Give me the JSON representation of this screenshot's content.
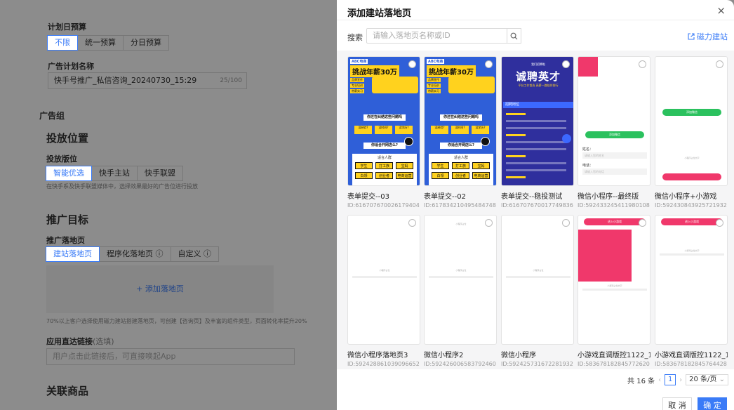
{
  "bg": {
    "budget_title": "计划日预算",
    "budget_opts": [
      "不限",
      "统一预算",
      "分日预算"
    ],
    "plan_name_label": "广告计划名称",
    "plan_name_value": "快手号推广_私信咨询_20240730_15:29",
    "plan_name_count": "25/100",
    "ad_group": "广告组",
    "placement_title": "投放位置",
    "placement_label": "投放版位",
    "placement_opts": [
      "智能优选",
      "快手主站",
      "快手联盟"
    ],
    "placement_hint": "在快手系及快手联盟媒体中，选择效果最好的广告位进行投放",
    "target_title": "推广目标",
    "landing_label": "推广落地页",
    "landing_opts": [
      "建站落地页",
      "程序化落地页 ⓘ",
      "自定义 ⓘ"
    ],
    "add_landing": "+ 添加落地页",
    "landing_hint": "70%以上客户选择使用磁力建站搭建落地页，可创建【咨询页】及丰富的组件类型，页面转化率提升20%",
    "deeplink_label": "应用直达链接",
    "deeplink_optional": "(选填)",
    "deeplink_placeholder": "用户点击此链接后，可直接唤起App",
    "product_title": "关联商品"
  },
  "drawer": {
    "title": "添加建站落地页",
    "close": "×",
    "search_label": "搜索",
    "search_placeholder": "请输入落地页名称或ID",
    "magnet_link": "磁力建站",
    "cards": [
      {
        "name": "表单提交--03",
        "id": "ID:616707670026179404",
        "kind": "poster"
      },
      {
        "name": "表单提交--02",
        "id": "ID:617834210495484748",
        "kind": "poster"
      },
      {
        "name": "表单提交--稳投测试",
        "id": "ID:616707670017749836",
        "kind": "recruit"
      },
      {
        "name": "微信小程序--最终版",
        "id": "ID:592433245411980108",
        "kind": "form"
      },
      {
        "name": "微信小程序+小游戏",
        "id": "ID:592430843925721932",
        "kind": "wechat"
      },
      {
        "name": "微信小程序落地页3",
        "id": "ID:592428861039096652",
        "kind": "blank"
      },
      {
        "name": "微信小程序2",
        "id": "ID:592426006583792460",
        "kind": "blank2"
      },
      {
        "name": "微信小程序",
        "id": "ID:592425731672281932",
        "kind": "blank"
      },
      {
        "name": "小游戏直调版控1122_1_1",
        "id": "ID:583678182845772620",
        "kind": "game"
      },
      {
        "name": "小游戏直调版控1122_1",
        "id": "ID:583678182845764428",
        "kind": "game2"
      }
    ],
    "poster": {
      "tag": "ABC电商",
      "headline": "挑战年薪30万",
      "chips": [
        "品牌宣传",
        "专业培训",
        "带薪实习"
      ],
      "q1": "你还在纠结这些问题吗",
      "opts": [
        "没经验?",
        "没时间?",
        "没学历?"
      ],
      "q2": "你适合开网店么?",
      "q3": "适合人群",
      "groups": [
        "学生",
        "打工族",
        "宝妈",
        "白领",
        "创业者",
        "电商运营"
      ]
    },
    "recruit": {
      "small": "我们招聘啦",
      "headline": "诚聘英才",
      "sub": "平台工作首选 高薪一路陪伴前行",
      "section": "招聘岗位"
    },
    "form": {
      "wx_btn": "添加微信",
      "name_label": "姓名：",
      "name_ph": "请输入您的姓名",
      "phone_label": "电话：",
      "phone_ph": "请输入您的电话"
    },
    "wechat": {
      "btn": "添加微信",
      "text": "小程序占位文字"
    },
    "blank": {
      "text": "小程序占位"
    },
    "game": {
      "btn": "进入小游戏",
      "text": "小游戏占位文字"
    },
    "pager": {
      "total": "共 16 条",
      "prev": "‹",
      "page": "1",
      "next": "›",
      "size": "20 条/页",
      "size_icon": "⌄"
    },
    "footer": {
      "cancel": "取 消",
      "ok": "确 定"
    }
  },
  "colors": {
    "accent": "#3a7bf7",
    "poster_bg": "#2f5fd8",
    "poster_yellow": "#ffd21e",
    "recruit_bg": "#2f2f9d",
    "wx_green": "#2bc15e",
    "game_pink": "#f0386b"
  }
}
